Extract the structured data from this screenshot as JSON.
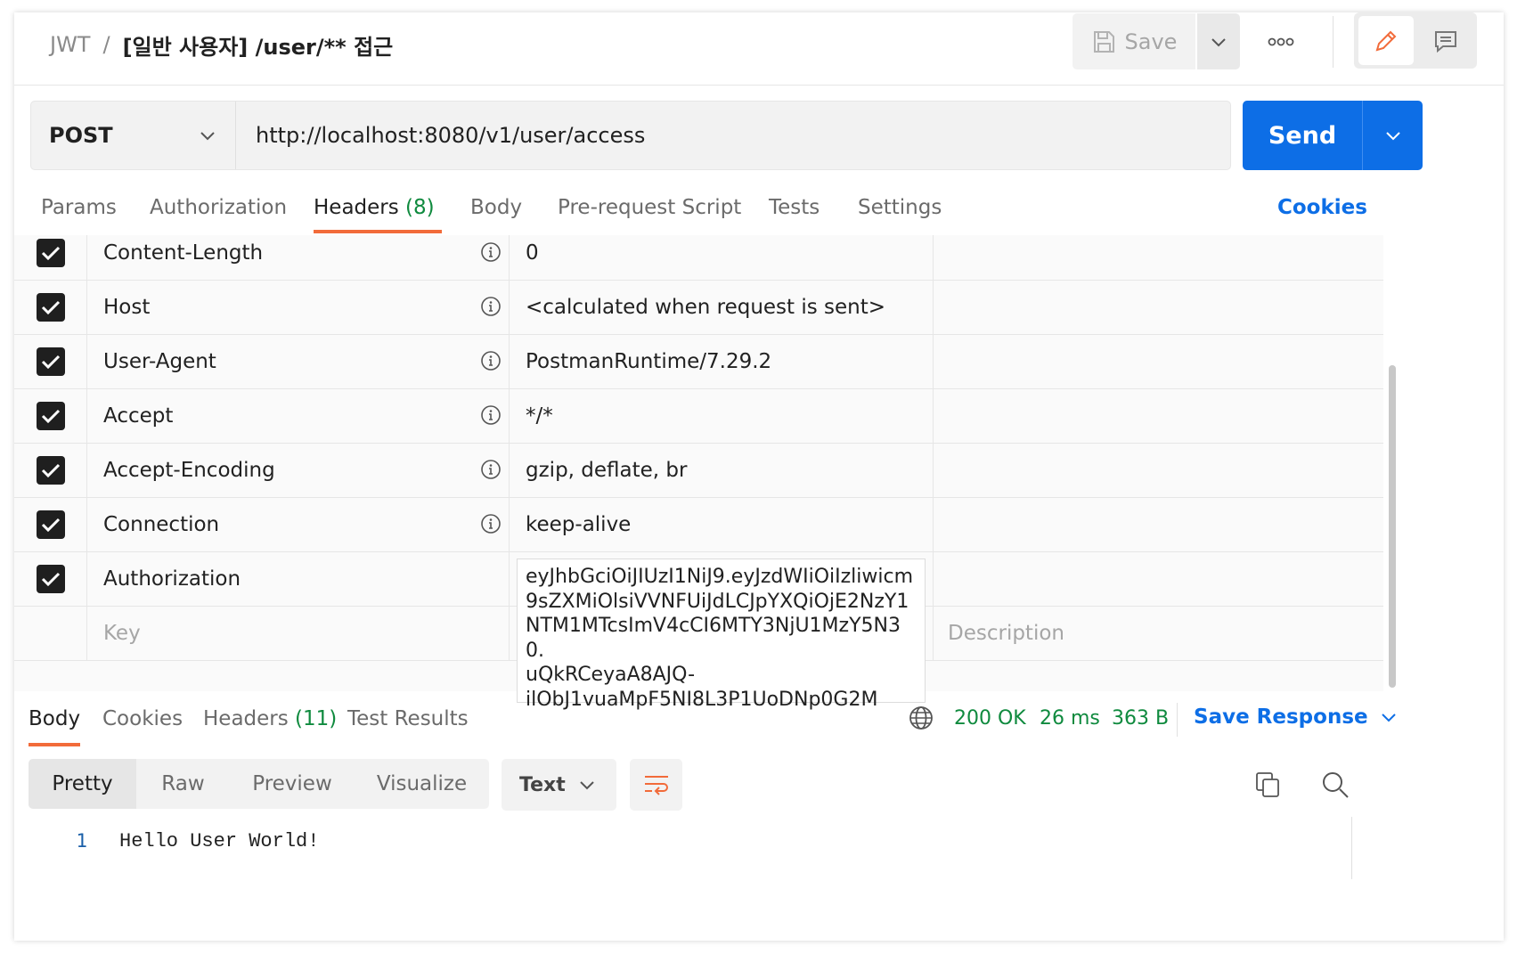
{
  "header": {
    "collection": "JWT",
    "separator": "/",
    "request_name": "[일반 사용자] /user/** 접근",
    "save_label": "Save"
  },
  "request": {
    "method": "POST",
    "url": "http://localhost:8080/v1/user/access",
    "send_label": "Send"
  },
  "request_tabs": [
    {
      "label": "Params"
    },
    {
      "label": "Authorization"
    },
    {
      "label": "Headers",
      "count": "(8)",
      "active": true
    },
    {
      "label": "Body"
    },
    {
      "label": "Pre-request Script"
    },
    {
      "label": "Tests"
    },
    {
      "label": "Settings"
    }
  ],
  "cookies_label": "Cookies",
  "headers_table": {
    "rows": [
      {
        "checked": true,
        "key": "Content-Length",
        "value": "0",
        "auto": true
      },
      {
        "checked": true,
        "key": "Host",
        "value": "<calculated when request is sent>",
        "auto": true
      },
      {
        "checked": true,
        "key": "User-Agent",
        "value": "PostmanRuntime/7.29.2",
        "auto": true
      },
      {
        "checked": true,
        "key": "Accept",
        "value": "*/*",
        "auto": true
      },
      {
        "checked": true,
        "key": "Accept-Encoding",
        "value": "gzip, deflate, br",
        "auto": true
      },
      {
        "checked": true,
        "key": "Connection",
        "value": "keep-alive",
        "auto": true
      },
      {
        "checked": true,
        "key": "Authorization",
        "value": "eyJhbGciOiJIUzI1NiJ9.eyJzdWIiOiIzliwicm9sZXMiOlsiVVNFUiJdLCJpYXQiOjE2NzY1NTM1MTcsImV4cCI6MTY3NjU1MzY5N30.uQkRCeyaA8AJQ-ilObJ1vuaMpF5NI8L3P1UoDNp0G2M",
        "auto": false
      }
    ],
    "token_lines": [
      "eyJhbGciOiJIUzI1NiJ9.eyJzdWIiOiIzliwicm",
      "9sZXMiOlsiVVNFUiJdLCJpYXQiOjE2NzY1",
      "NTM1MTcsImV4cCI6MTY3NjU1MzY5N30.",
      "uQkRCeyaA8AJQ-",
      "ilObJ1vuaMpF5NI8L3P1UoDNp0G2M"
    ],
    "key_placeholder": "Key",
    "description_placeholder": "Description"
  },
  "response": {
    "tabs": [
      {
        "label": "Body",
        "active": true
      },
      {
        "label": "Cookies"
      },
      {
        "label": "Headers",
        "count": "(11)"
      },
      {
        "label": "Test Results"
      }
    ],
    "status": "200 OK",
    "time": "26 ms",
    "size": "363 B",
    "save_response_label": "Save Response",
    "view_modes": [
      "Pretty",
      "Raw",
      "Preview",
      "Visualize"
    ],
    "active_view": "Pretty",
    "format": "Text",
    "body_lines": [
      {
        "line_no": "1",
        "text": "Hello User World!"
      }
    ]
  },
  "colors": {
    "accent_orange": "#f26b3a",
    "send_blue": "#0d6ee6",
    "status_green": "#0f8a3e"
  },
  "icons": [
    "save-icon",
    "chevron-down-icon",
    "more-icon",
    "pencil-icon",
    "comment-icon",
    "info-icon",
    "checkbox-checked-icon",
    "globe-icon",
    "wrap-icon",
    "copy-icon",
    "search-icon"
  ]
}
